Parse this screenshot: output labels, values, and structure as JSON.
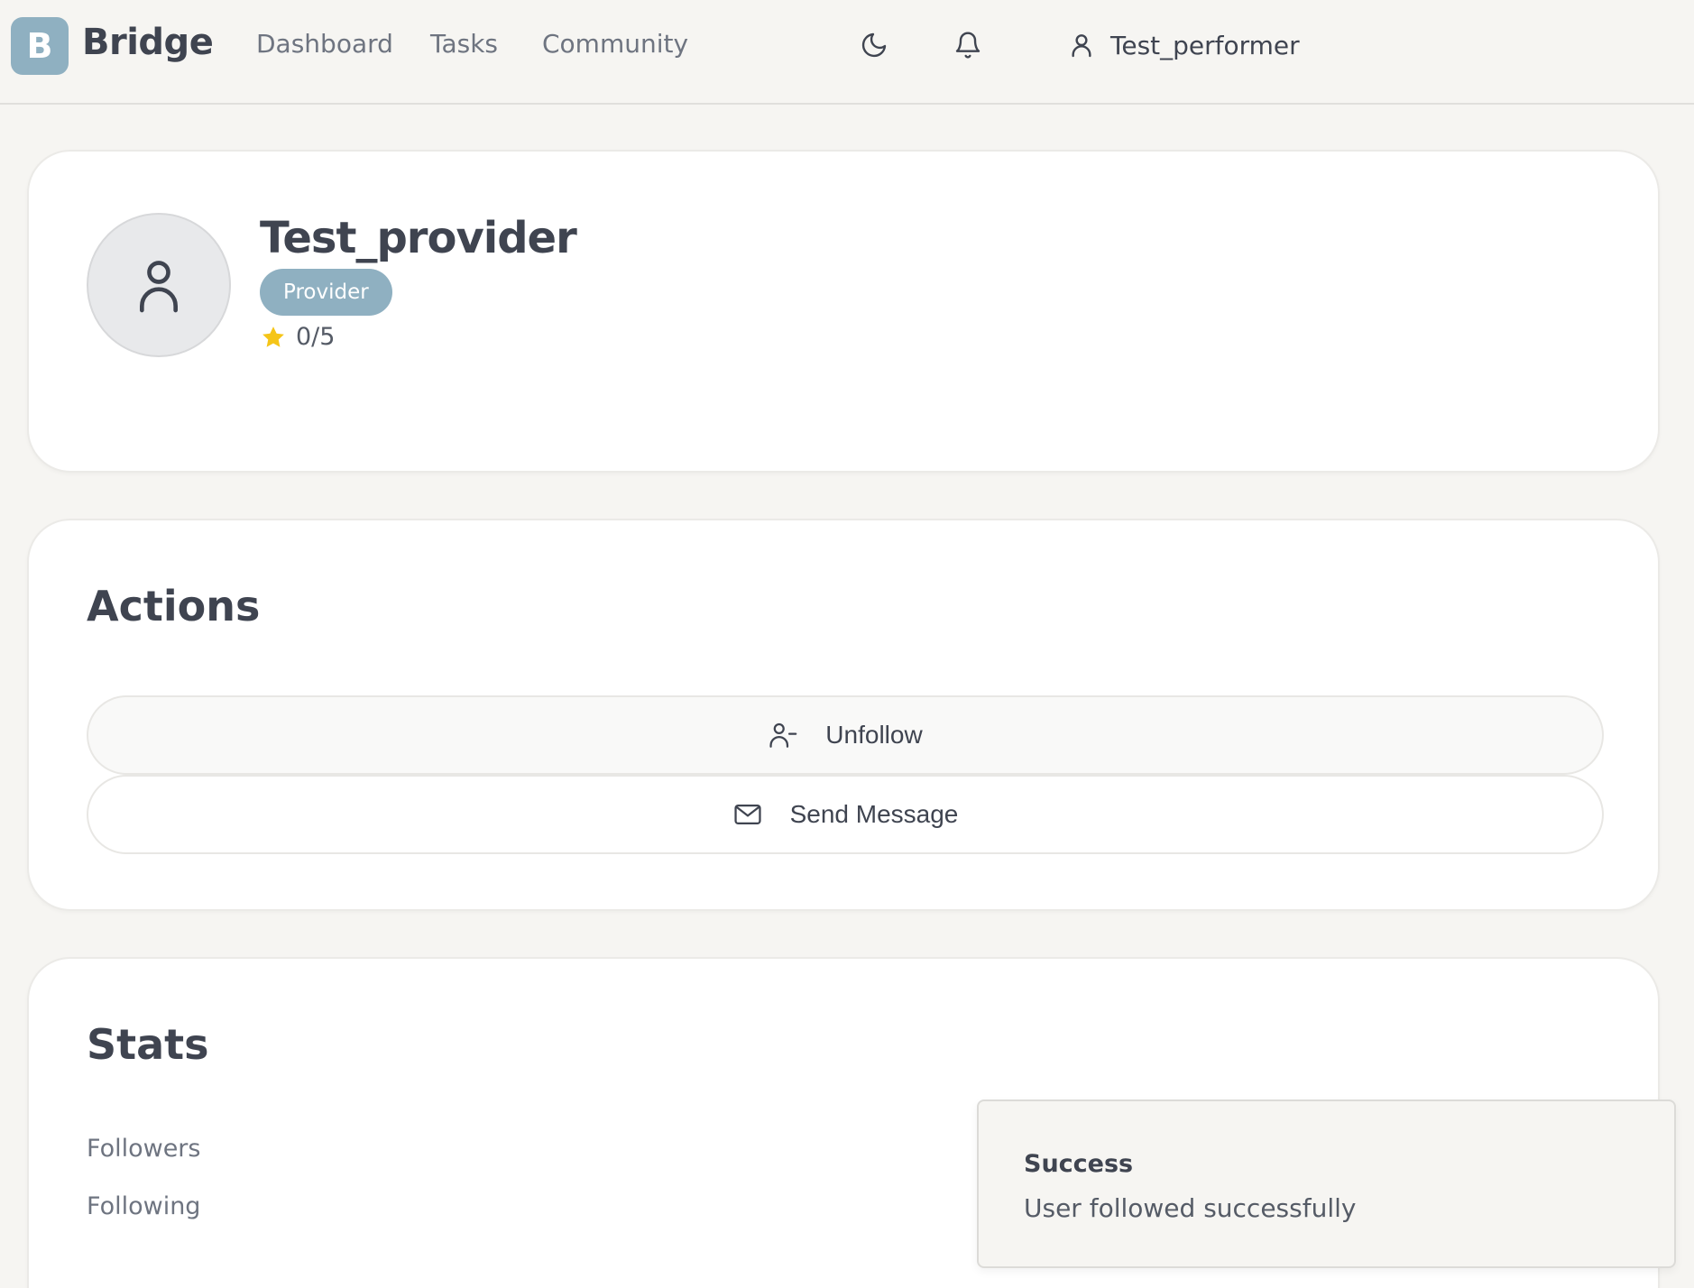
{
  "header": {
    "logo_letter": "B",
    "brand": "Bridge",
    "nav": [
      "Dashboard",
      "Tasks",
      "Community"
    ],
    "username": "Test_performer",
    "theme_icon": "moon-icon",
    "notifications_icon": "bell-icon"
  },
  "profile": {
    "name": "Test_provider",
    "role": "Provider",
    "rating": "0/5"
  },
  "actions": {
    "title": "Actions",
    "unfollow_label": "Unfollow",
    "message_label": "Send Message"
  },
  "stats": {
    "title": "Stats",
    "followers_label": "Followers",
    "following_label": "Following"
  },
  "toast": {
    "title": "Success",
    "message": "User followed successfully"
  },
  "colors": {
    "accent": "#8fb0c1",
    "background": "#f6f5f2",
    "star": "#f5c518"
  }
}
